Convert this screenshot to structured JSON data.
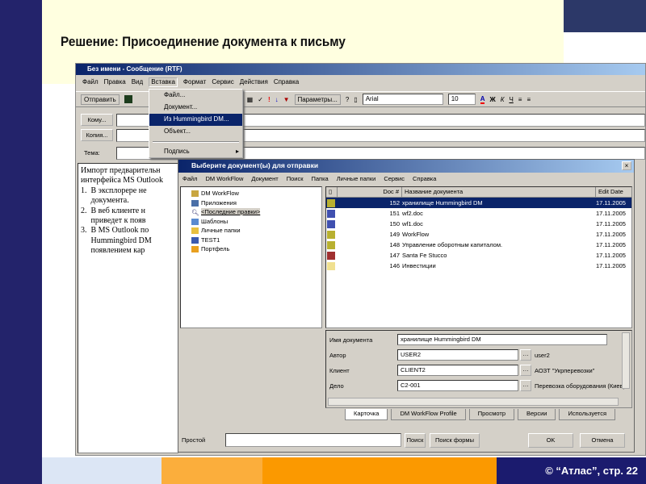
{
  "slide": {
    "title": "Решение: Присоединение документа к письму",
    "footer": "© “Атлас”, стр.  22"
  },
  "outlook": {
    "title": "Без имени - Сообщение (RTF)",
    "menu": [
      "Файл",
      "Правка",
      "Вид",
      "Вставка",
      "Формат",
      "Сервис",
      "Действия",
      "Справка"
    ],
    "toolbar": {
      "send": "Отправить",
      "params": "Параметры...",
      "font": "Arial",
      "size": "10",
      "bold": "Ж",
      "italic": "К",
      "underline": "Ч"
    },
    "to_label": "Кому...",
    "cc_label": "Копия...",
    "subject_label": "Тема:",
    "body_lines": [
      "Импорт предварительн",
      "интерфейса MS Outlook",
      "1.  В эксплорере не",
      "     документа.",
      "2.  В веб клиенте н",
      "     приведет к появ",
      "3.  В MS Outlook по",
      "     Hummingbird DM",
      "     появлением кар"
    ],
    "insert_menu": [
      "Файл...",
      "Документ...",
      "Из Hummingbird DM...",
      "Объект...",
      "Подпись"
    ]
  },
  "dialog": {
    "title": "Выберите документ(ы) для отправки",
    "menu": [
      "Файл",
      "DM WorkFlow",
      "Документ",
      "Поиск",
      "Папка",
      "Личные папки",
      "Сервис",
      "Справка"
    ],
    "tree": [
      "DM WorkFlow",
      "Приложения",
      "<Последние правки>",
      "Шаблоны",
      "Личные папки",
      "TEST1",
      "Портфель"
    ],
    "columns": [
      "Doc #",
      "Название документа",
      "Edit Date"
    ],
    "rows": [
      {
        "num": "152",
        "name": "хранилище Hummingbird DM",
        "date": "17.11.2005",
        "icon": "workflow-icon"
      },
      {
        "num": "151",
        "name": "wf2.doc",
        "date": "17.11.2005",
        "icon": "word-doc-icon"
      },
      {
        "num": "150",
        "name": "wf1.doc",
        "date": "17.11.2005",
        "icon": "word-doc-icon"
      },
      {
        "num": "149",
        "name": "WorkFlow",
        "date": "17.11.2005",
        "icon": "workflow-icon"
      },
      {
        "num": "148",
        "name": "Управление оборотным капиталом.",
        "date": "17.11.2005",
        "icon": "workflow-icon"
      },
      {
        "num": "147",
        "name": "Santa Fe Stucco",
        "date": "17.11.2005",
        "icon": "form-icon"
      },
      {
        "num": "146",
        "name": "Инвестиции",
        "date": "17.11.2005",
        "icon": "folder-icon"
      }
    ],
    "details": [
      {
        "label": "Имя документа",
        "value": "хранилище Hummingbird DM",
        "extra": ""
      },
      {
        "label": "Автор",
        "value": "USER2",
        "extra": "user2"
      },
      {
        "label": "Клиент",
        "value": "CLIENT2",
        "extra": "АОЗТ \"Укрперевозки\""
      },
      {
        "label": "Дело",
        "value": "C2-001",
        "extra": "Перевозка оборудования (Киев)"
      }
    ],
    "tabs": [
      "Карточка",
      "DM WorkFlow Profile",
      "Просмотр",
      "Версии",
      "Используется"
    ],
    "simple_label": "Простой",
    "search": "Поиск",
    "search_form": "Поиск формы",
    "ok": "OK",
    "cancel": "Отмена"
  }
}
